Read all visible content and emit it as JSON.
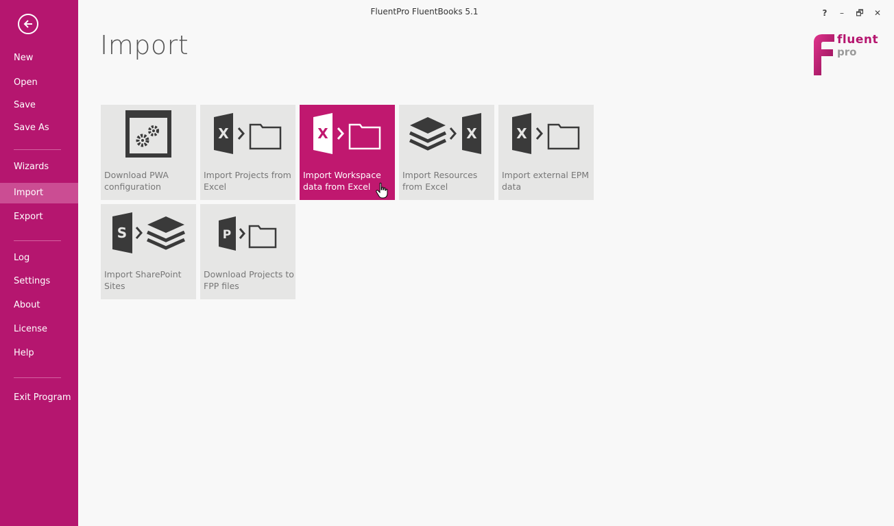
{
  "window": {
    "title": "FluentPro FluentBooks 5.1",
    "controls": [
      "?",
      "–",
      "🗗",
      "✕"
    ]
  },
  "sidebar": {
    "back_icon": "arrow-left-circle-icon",
    "items": [
      {
        "label": "New"
      },
      {
        "label": "Open"
      },
      {
        "label": "Save"
      },
      {
        "label": "Save As"
      },
      {
        "label": "Wizards"
      },
      {
        "label": "Import",
        "active": true
      },
      {
        "label": "Export"
      },
      {
        "label": "Log"
      },
      {
        "label": "Settings"
      },
      {
        "label": "About"
      },
      {
        "label": "License"
      },
      {
        "label": "Help"
      },
      {
        "label": "Exit Program"
      }
    ]
  },
  "main": {
    "title": "Import",
    "logo": {
      "line1": "fluent",
      "line2": "pro"
    },
    "tiles": [
      {
        "label": "Download PWA configuration",
        "icon": "pwa-settings-icon"
      },
      {
        "label": "Import Projects from Excel",
        "icon": "excel-to-folder-icon"
      },
      {
        "label": "Import Workspace data from Excel",
        "icon": "excel-to-folder-icon",
        "selected": true
      },
      {
        "label": "Import Resources from Excel",
        "icon": "layers-to-excel-icon"
      },
      {
        "label": "Import external EPM data",
        "icon": "excel-to-folder-icon"
      },
      {
        "label": "Import SharePoint Sites",
        "icon": "sharepoint-to-layers-icon"
      },
      {
        "label": "Download Projects to FPP files",
        "icon": "project-to-folder-icon"
      }
    ]
  },
  "colors": {
    "accent": "#b5166f",
    "selected_tile": "#c0186f",
    "tile_bg": "#e6e6e5",
    "icon_dark": "#3a3a3a"
  }
}
